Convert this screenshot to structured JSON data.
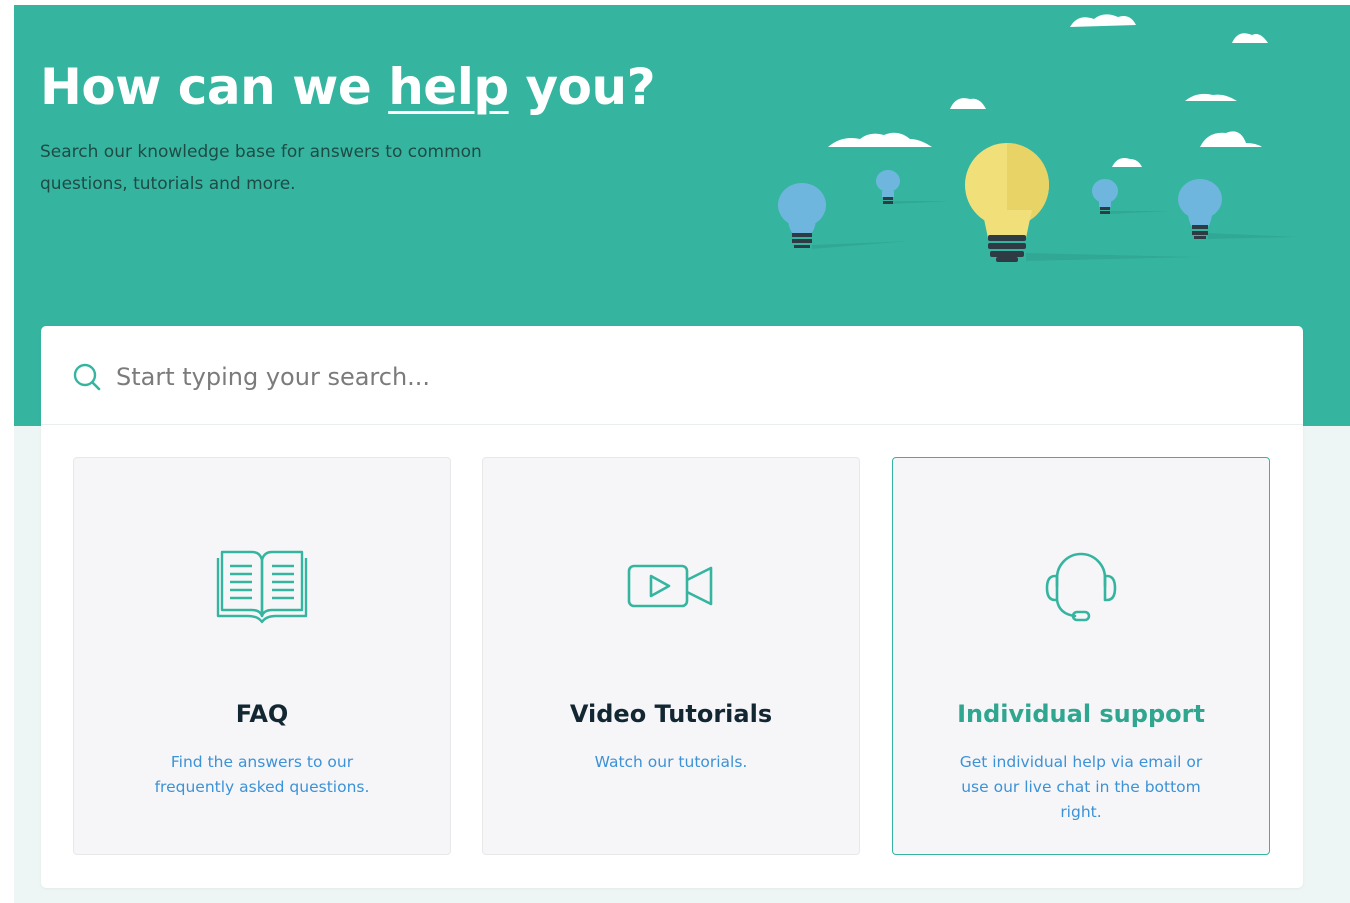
{
  "hero": {
    "title_before": "How can we ",
    "title_highlight": "help",
    "title_after": " you?",
    "subtitle": "Search our knowledge base for answers to common questions, tutorials and more."
  },
  "search": {
    "placeholder": "Start typing your search..."
  },
  "cards": [
    {
      "title": "FAQ",
      "description": "Find the answers to our frequently asked questions.",
      "icon": "book-icon"
    },
    {
      "title": "Video Tutorials",
      "description": "Watch our tutorials.",
      "icon": "video-camera-icon"
    },
    {
      "title": "Individual support",
      "description": "Get individual help via email or use our live chat in the bottom right.",
      "icon": "headset-icon"
    }
  ],
  "colors": {
    "brand": "#35b5a0",
    "link": "#3c92d7",
    "heading": "#132733",
    "bulb_main": "#f1e07a",
    "bulb_small": "#6fb6de"
  }
}
